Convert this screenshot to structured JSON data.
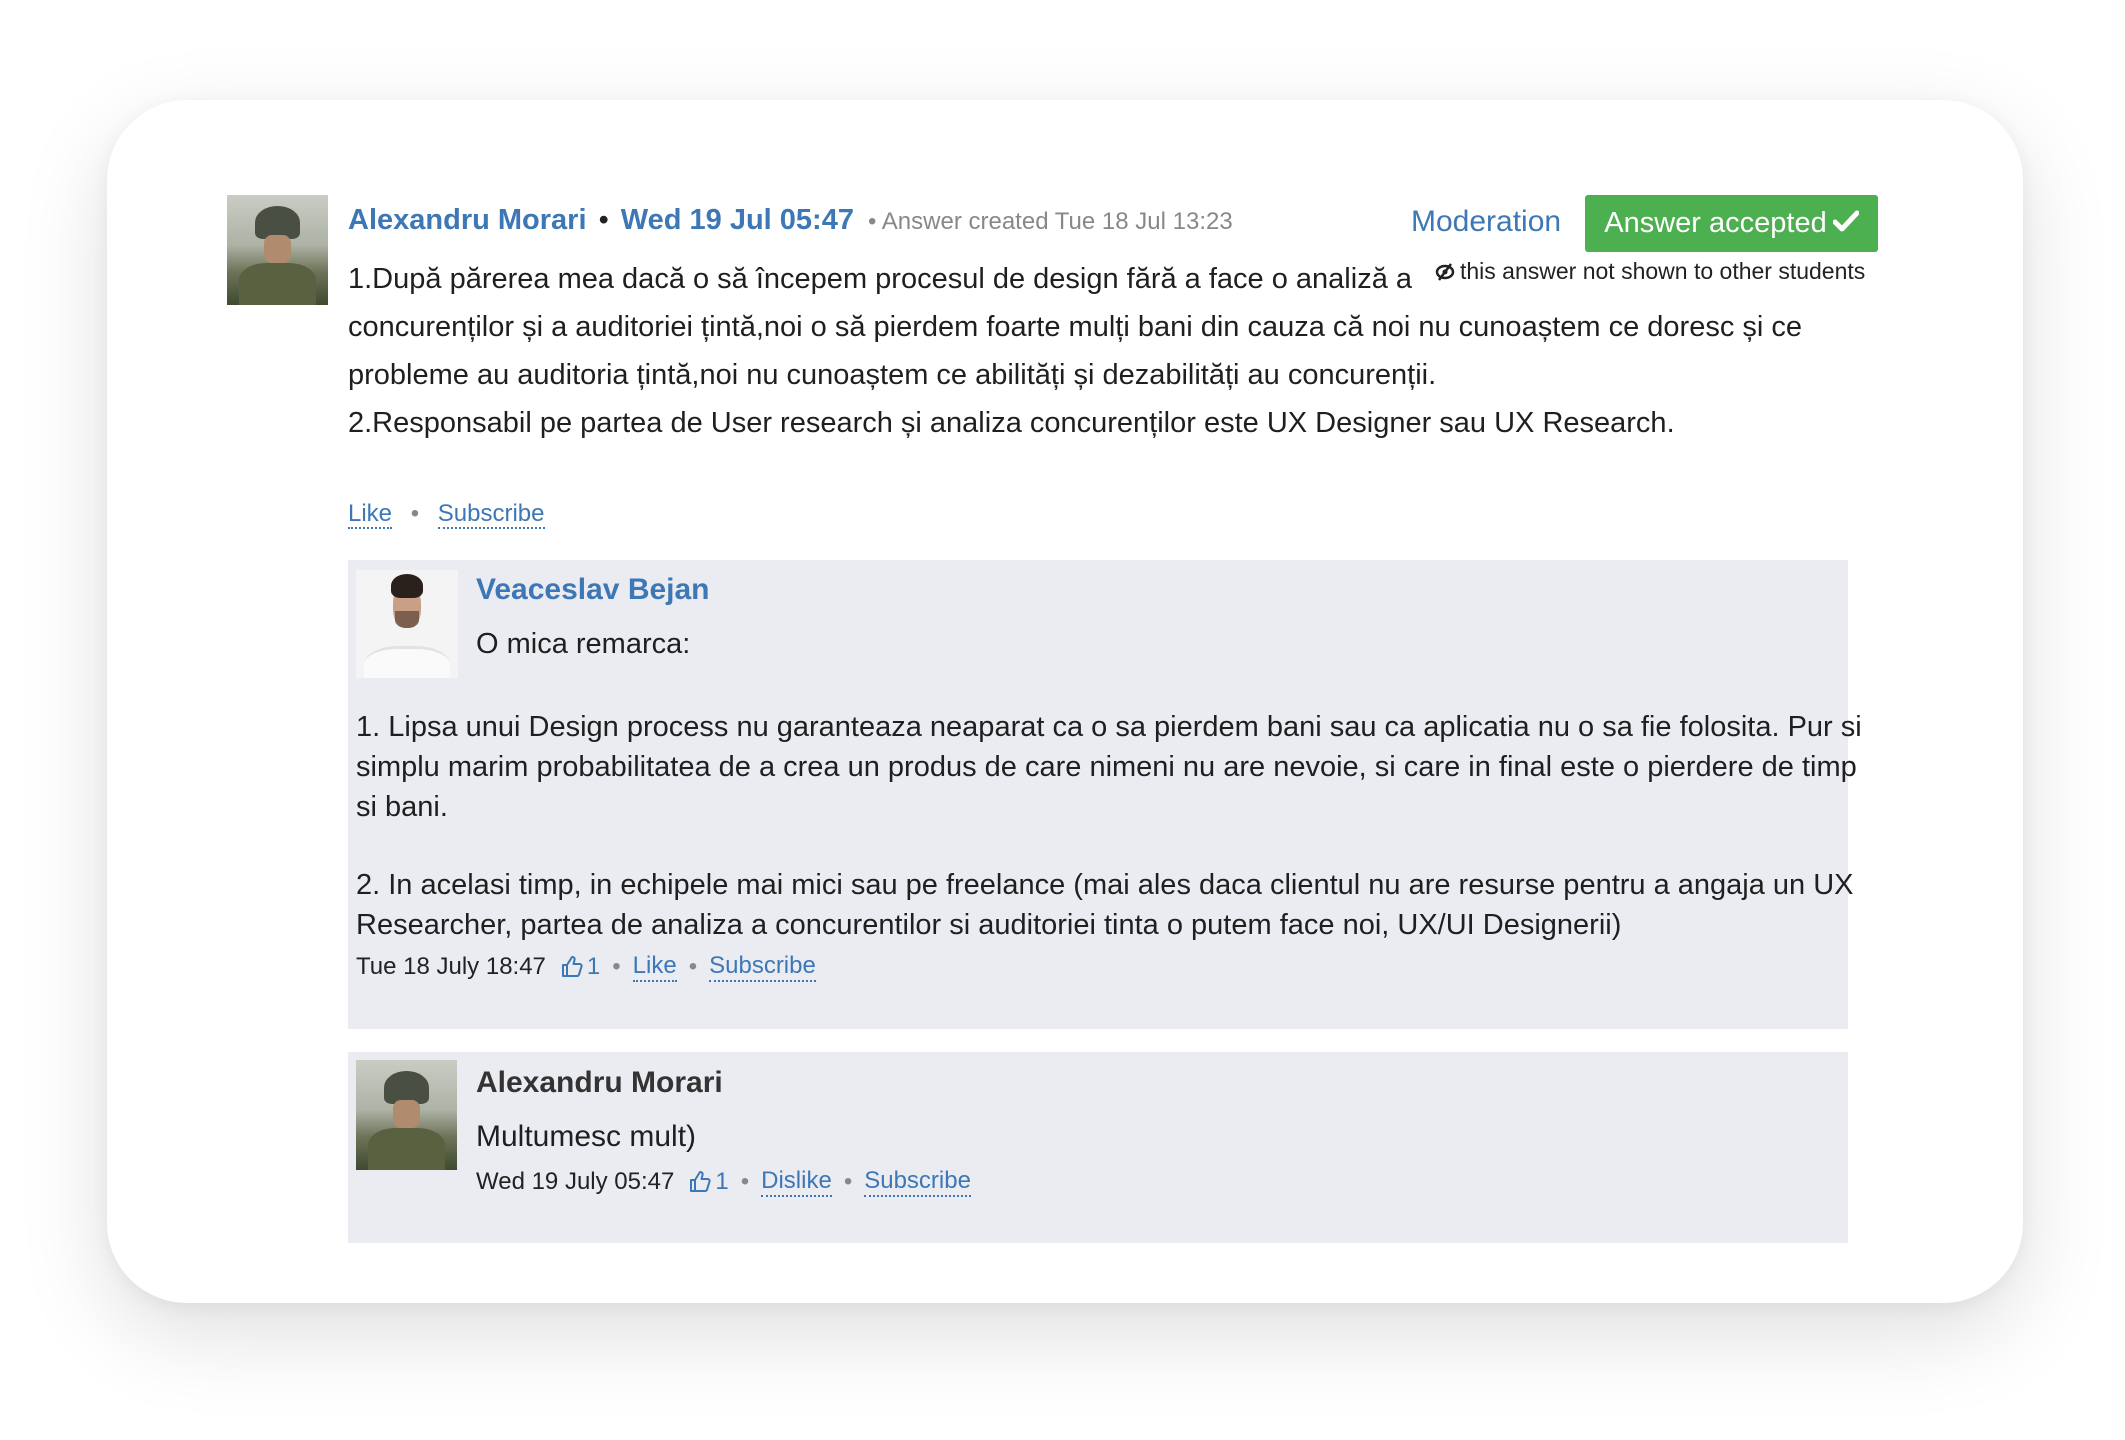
{
  "answer": {
    "author": "Alexandru Morari",
    "separator": "•",
    "date": "Wed 19 Jul 05:47",
    "created": "• Answer created Tue 18 Jul 13:23",
    "moderation_label": "Moderation",
    "accepted_label": "Answer accepted",
    "hidden_note": "this answer not shown to other students",
    "text_line1": "1.După părerea mea dacă o să începem procesul de design fără a face o analiză a",
    "text_line2": "concurenților și a auditoriei țintă,noi o să pierdem foarte mulți bani din cauza că noi nu cunoaștem ce doresc și ce",
    "text_line3": "probleme au auditoria țintă,noi nu cunoaștem ce abilități și dezabilități au concurenții.",
    "text_line4": "2.Responsabil pe partea de User research și analiza concurenților este UX Designer sau UX Research.",
    "like_label": "Like",
    "dot": "•",
    "subscribe_label": "Subscribe"
  },
  "reply1": {
    "author": "Veaceslav Bejan",
    "intro": "O mica remarca:",
    "p1_line1": "1. Lipsa unui Design process nu garanteaza neaparat ca o sa pierdem bani sau ca aplicatia nu o sa fie folosita. Pur si",
    "p1_line2": "simplu marim probabilitatea de a crea un produs de care nimeni nu are nevoie, si care in final este o pierdere de timp",
    "p1_line3": "si bani.",
    "p2_line1": "2. In acelasi timp, in echipele mai mici sau pe freelance (mai ales daca clientul nu are resurse pentru a angaja un UX",
    "p2_line2": "Researcher, partea de analiza a concurentilor si auditoriei tinta o putem face noi, UX/UI Designerii)",
    "date": "Tue 18 July 18:47",
    "likes": "1",
    "dot": "•",
    "like_label": "Like",
    "subscribe_label": "Subscribe"
  },
  "reply2": {
    "author": "Alexandru Morari",
    "text": "Multumesc mult)",
    "date": "Wed 19 July 05:47",
    "likes": "1",
    "dot": "•",
    "dislike_label": "Dislike",
    "subscribe_label": "Subscribe"
  },
  "colors": {
    "link": "#3d77b6",
    "accepted_bg": "#4caf50",
    "reply_bg": "#eaecf2"
  },
  "icons": [
    "eye-slash-icon",
    "check-icon",
    "thumbs-up-icon"
  ]
}
